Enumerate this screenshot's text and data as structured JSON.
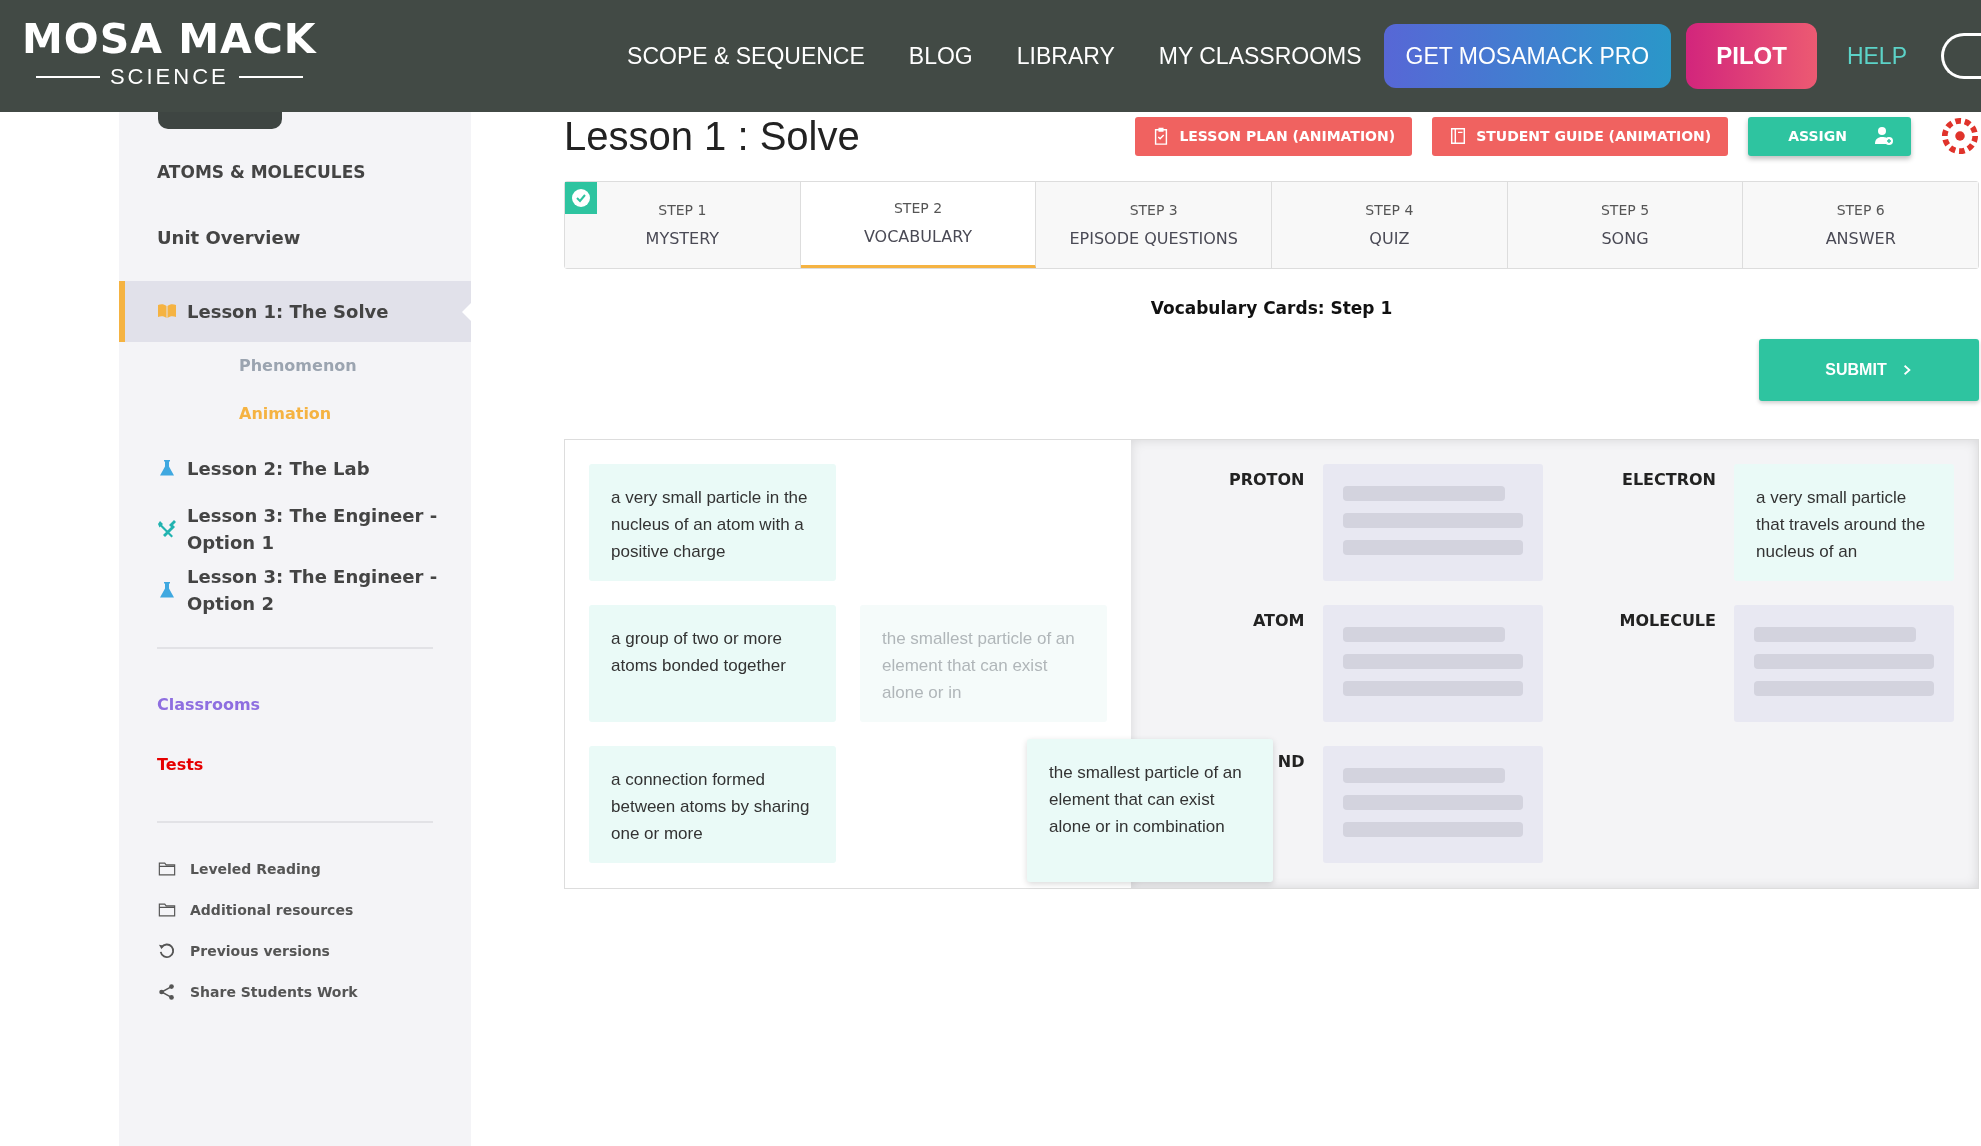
{
  "navbar": {
    "logo_title": "MOSA MACK",
    "logo_subtitle": "SCIENCE",
    "links": [
      {
        "label": "SCOPE & SEQUENCE",
        "kind": "link"
      },
      {
        "label": "BLOG",
        "kind": "link"
      },
      {
        "label": "LIBRARY",
        "kind": "link"
      },
      {
        "label": "MY CLASSROOMS",
        "kind": "link"
      },
      {
        "label": "GET MOSAMACK PRO",
        "kind": "pro"
      },
      {
        "label": "PILOT",
        "kind": "pilot"
      },
      {
        "label": "HELP",
        "kind": "help"
      }
    ]
  },
  "sidebar": {
    "unit_title": "ATOMS & MOLECULES",
    "overview": "Unit Overview",
    "lessons": [
      {
        "label": "Lesson 1: The Solve",
        "kind": "book",
        "selected": true,
        "children": [
          {
            "label": "Phenomenon",
            "selected": false
          },
          {
            "label": "Animation",
            "selected": true
          }
        ]
      },
      {
        "label": "Lesson 2: The Lab",
        "kind": "flask",
        "selected": false
      },
      {
        "label": "Lesson 3: The Engineer - Option 1",
        "kind": "tools",
        "selected": false
      },
      {
        "label": "Lesson 3: The Engineer - Option 2",
        "kind": "flask",
        "selected": false
      }
    ],
    "links": [
      {
        "label": "Classrooms",
        "color": "#8e6ee0"
      },
      {
        "label": "Tests",
        "color": "#e60000"
      }
    ],
    "resources": [
      {
        "label": "Leveled Reading",
        "kind": "folder"
      },
      {
        "label": "Additional resources",
        "kind": "folder"
      },
      {
        "label": "Previous versions",
        "kind": "history"
      },
      {
        "label": "Share Students Work",
        "kind": "share"
      }
    ]
  },
  "header": {
    "title": "Lesson 1 : Solve",
    "buttons": [
      {
        "label": "LESSON PLAN (ANIMATION)",
        "kind": "plan"
      },
      {
        "label": "STUDENT GUIDE (ANIMATION)",
        "kind": "guide"
      },
      {
        "label": "ASSIGN",
        "kind": "assign"
      }
    ]
  },
  "steps": [
    {
      "number": "STEP 1",
      "name": "MYSTERY",
      "selected": false,
      "completed": true
    },
    {
      "number": "STEP 2",
      "name": "VOCABULARY",
      "selected": true,
      "completed": false
    },
    {
      "number": "STEP 3",
      "name": "EPISODE QUESTIONS",
      "selected": false,
      "completed": false
    },
    {
      "number": "STEP 4",
      "name": "QUIZ",
      "selected": false,
      "completed": false
    },
    {
      "number": "STEP 5",
      "name": "SONG",
      "selected": false,
      "completed": false
    },
    {
      "number": "STEP 6",
      "name": "ANSWER",
      "selected": false,
      "completed": false
    }
  ],
  "activity": {
    "title": "Vocabulary Cards: Step 1",
    "submit": "SUBMIT",
    "pool": [
      {
        "kind": "card",
        "text": "a very small particle in the nucleus of an atom with a positive charge"
      },
      {
        "kind": "card",
        "text": "a group of two or more atoms bonded together"
      },
      {
        "kind": "ghost",
        "text": "the smallest particle of an element that can exist alone or in"
      },
      {
        "kind": "card",
        "text": "a connection formed between atoms by sharing one or more"
      }
    ],
    "targets": [
      {
        "term": "PROTON",
        "kind": "empty"
      },
      {
        "term": "ELECTRON",
        "kind": "filled",
        "card": "a very small particle that travels around the nucleus of an"
      },
      {
        "term": "ATOM",
        "kind": "empty"
      },
      {
        "term": "MOLECULE",
        "kind": "empty"
      },
      {
        "term": "ND",
        "kind": "empty"
      }
    ],
    "dragging": {
      "text": "the smallest particle of an element that can exist alone or in combination"
    }
  }
}
